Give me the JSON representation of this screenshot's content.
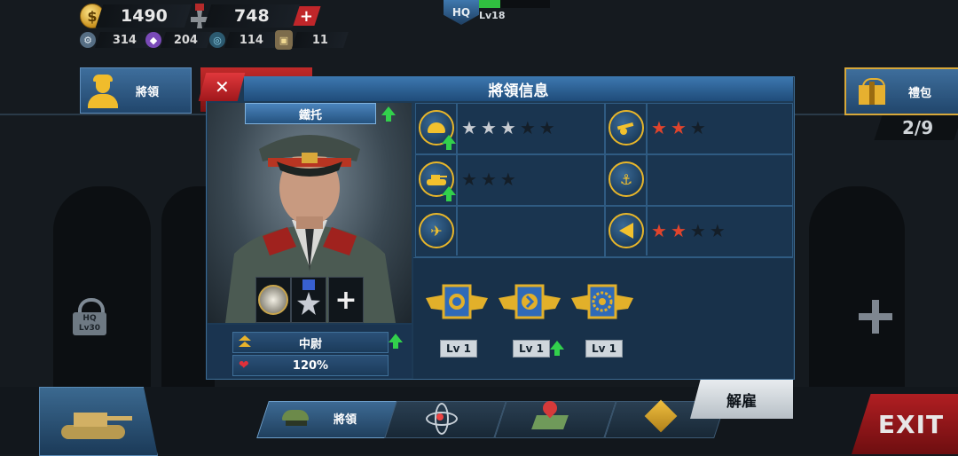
{
  "resources": {
    "gold": "1490",
    "medals": "748",
    "gear": "314",
    "purple": "204",
    "steel": "114",
    "shield": "11"
  },
  "hq": {
    "badge": "HQ",
    "level": "Lv18"
  },
  "left_button": {
    "label": "將領"
  },
  "gift_button": {
    "label": "禮包"
  },
  "slot_counter": "2/9",
  "locked_slot": {
    "hq": "HQ",
    "level": "Lv30"
  },
  "dialog": {
    "title": "將領信息",
    "close": "✕",
    "general_name": "鐵托",
    "rank": "中尉",
    "health": "120%",
    "add_medal": "+",
    "skills": [
      {
        "icon": "infantry-helmet-icon",
        "stars_filled": 3,
        "stars_total": 5,
        "star_color": "silver",
        "upgrade": true
      },
      {
        "icon": "artillery-icon",
        "stars_filled": 2,
        "stars_total": 3,
        "star_color": "red",
        "upgrade": false
      },
      {
        "icon": "tank-icon",
        "stars_filled": 0,
        "stars_total": 3,
        "star_color": "silver",
        "upgrade": true
      },
      {
        "icon": "anchor-icon",
        "stars_filled": 0,
        "stars_total": 0,
        "star_color": "none",
        "upgrade": false
      },
      {
        "icon": "airplane-icon",
        "stars_filled": 0,
        "stars_total": 0,
        "star_color": "none",
        "upgrade": false
      },
      {
        "icon": "command-icon",
        "stars_filled": 2,
        "stars_total": 4,
        "star_color": "red",
        "upgrade": false
      }
    ],
    "badges": [
      {
        "level": "Lv 1",
        "upgrade": false
      },
      {
        "level": "Lv 1",
        "upgrade": true
      },
      {
        "level": "Lv 1",
        "upgrade": false
      }
    ]
  },
  "dismiss_label": "解雇",
  "tabs": [
    {
      "label": "將領",
      "active": true
    },
    {
      "label": "",
      "active": false
    },
    {
      "label": "",
      "active": false
    },
    {
      "label": "",
      "active": false
    }
  ],
  "exit_label": "EXIT"
}
